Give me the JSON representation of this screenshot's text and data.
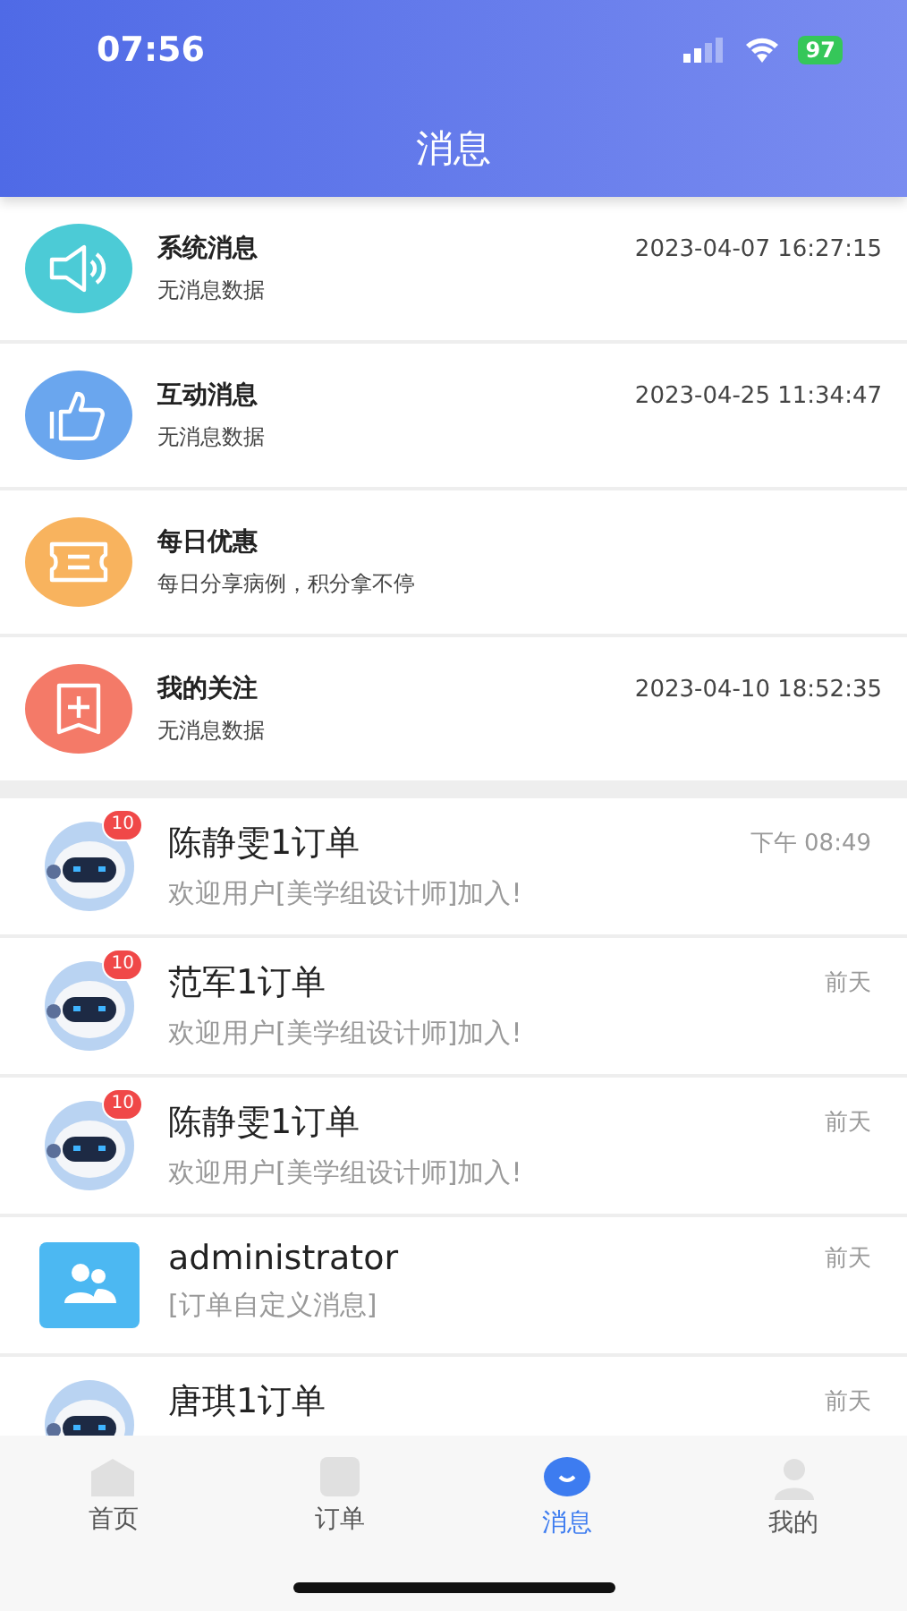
{
  "status_bar": {
    "time": "07:56",
    "battery": "97"
  },
  "header": {
    "title": "消息"
  },
  "categories": [
    {
      "kind": "speaker",
      "color": "#4ccbd6",
      "title": "系统消息",
      "subtitle": "无消息数据",
      "time": "2023-04-07 16:27:15"
    },
    {
      "kind": "thumb",
      "color": "#6aa6ee",
      "title": "互动消息",
      "subtitle": "无消息数据",
      "time": "2023-04-25 11:34:47"
    },
    {
      "kind": "ticket",
      "color": "#f8b35e",
      "title": "每日优惠",
      "subtitle": "每日分享病例，积分拿不停"
    },
    {
      "kind": "bookmark",
      "color": "#f47a68",
      "title": "我的关注",
      "subtitle": "无消息数据",
      "time": "2023-04-10 18:52:35"
    }
  ],
  "chats": [
    {
      "kind": "robot",
      "badge": "10",
      "name": "陈静雯1订单",
      "preview": "欢迎用户[美学组设计师]加入!",
      "time": "下午 08:49"
    },
    {
      "kind": "robot",
      "badge": "10",
      "name": "范军1订单",
      "preview": "欢迎用户[美学组设计师]加入!",
      "time": "前天"
    },
    {
      "kind": "robot",
      "badge": "10",
      "name": "陈静雯1订单",
      "preview": "欢迎用户[美学组设计师]加入!",
      "time": "前天"
    },
    {
      "kind": "group",
      "name": "administrator",
      "preview": "[订单自定义消息]",
      "time": "前天"
    },
    {
      "kind": "robot",
      "name": "唐琪1订单",
      "time": "前天"
    }
  ],
  "tab_bar": [
    {
      "kind": "home",
      "label": "首页",
      "selected": false
    },
    {
      "kind": "order",
      "label": "订单",
      "selected": false
    },
    {
      "kind": "message",
      "label": "消息",
      "selected": true
    },
    {
      "kind": "me",
      "label": "我的",
      "selected": false
    }
  ]
}
